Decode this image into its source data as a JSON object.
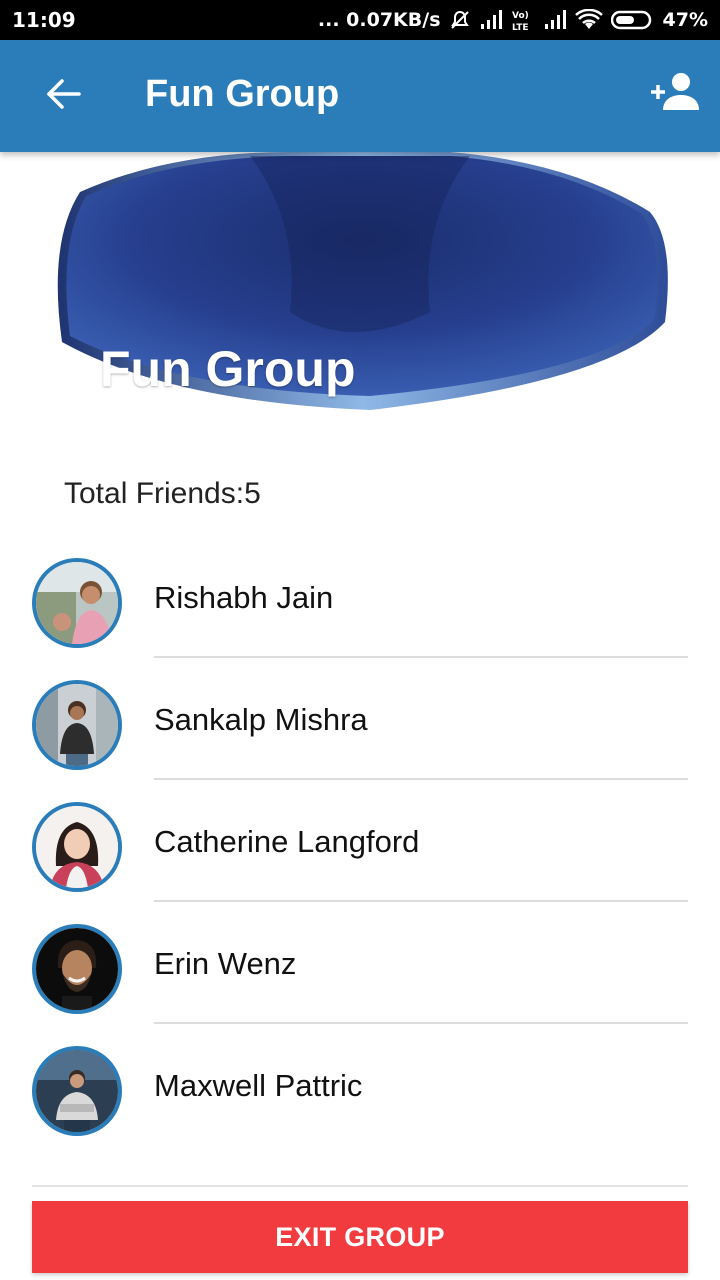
{
  "status_bar": {
    "time": "11:09",
    "network_speed": "... 0.07KB/s",
    "battery": "47%",
    "icons": [
      "mute-bell-icon",
      "signal-icon",
      "volte-icon",
      "signal-icon",
      "wifi-icon",
      "battery-icon"
    ]
  },
  "app_bar": {
    "title": "Fun Group",
    "back_icon": "arrow-back-icon",
    "add_icon": "person-add-icon",
    "color": "#2a7db8"
  },
  "banner": {
    "title": "Fun Group"
  },
  "summary": {
    "total_friends": "Total Friends:5"
  },
  "members": [
    {
      "name": "Rishabh Jain"
    },
    {
      "name": "Sankalp Mishra"
    },
    {
      "name": "Catherine Langford"
    },
    {
      "name": "Erin Wenz"
    },
    {
      "name": "Maxwell Pattric"
    }
  ],
  "actions": {
    "exit_label": "EXIT GROUP",
    "exit_color": "#f23b3e"
  }
}
